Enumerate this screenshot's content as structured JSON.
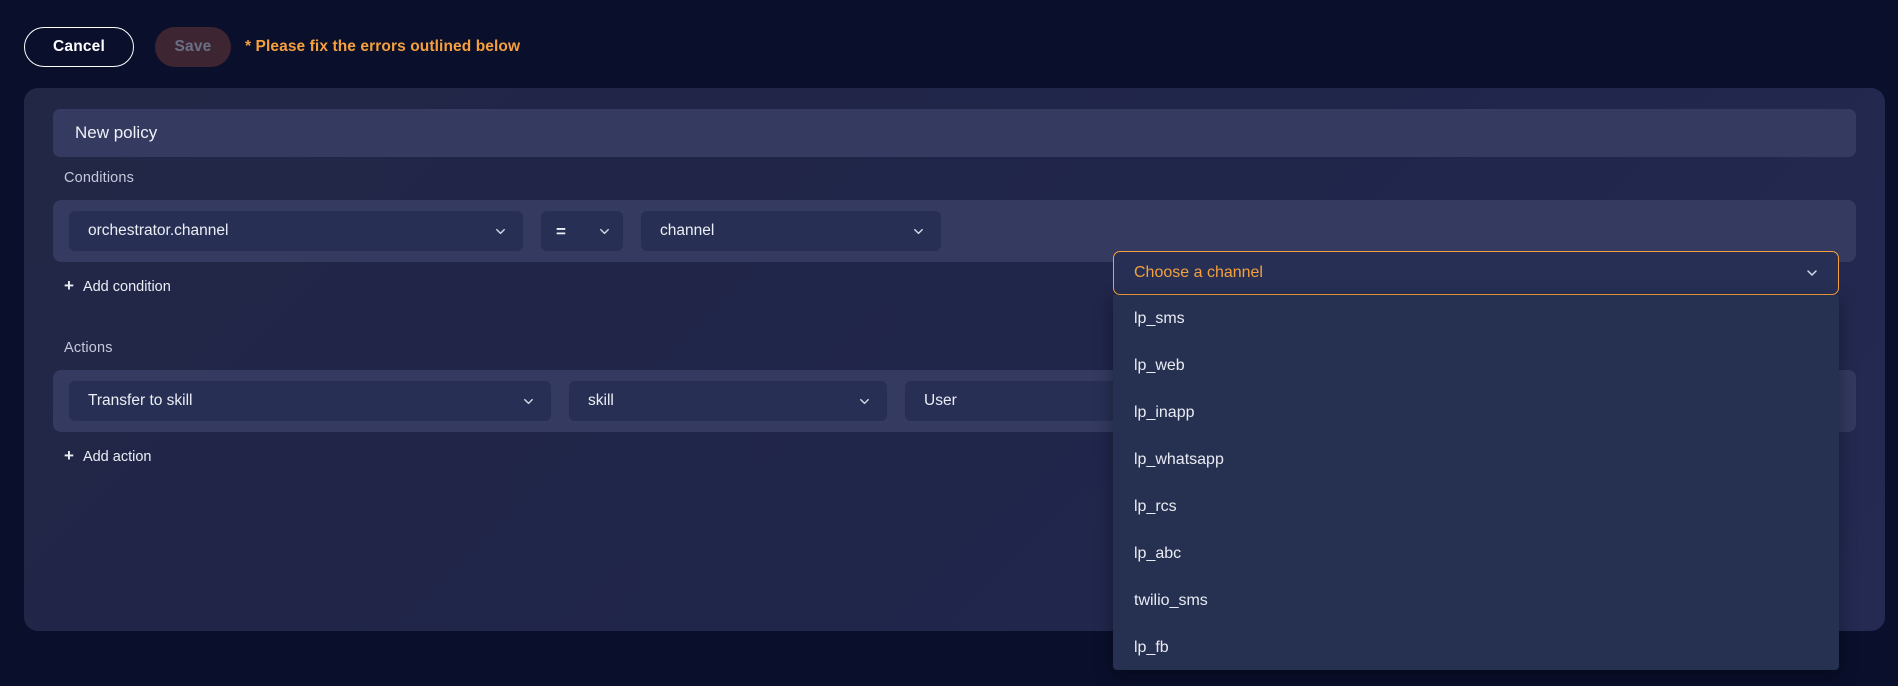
{
  "toolbar": {
    "cancel_label": "Cancel",
    "save_label": "Save",
    "error_message": "* Please fix the errors outlined below",
    "error_color": "#f5a03c"
  },
  "card": {
    "policy_title": "New policy",
    "conditions_label": "Conditions",
    "actions_label": "Actions",
    "add_condition_label": "Add condition",
    "add_action_label": "Add action",
    "plus_glyph": "+"
  },
  "condition_row": {
    "field": "orchestrator.channel",
    "operator": "=",
    "value_type": "channel"
  },
  "action_row": {
    "action": "Transfer to skill",
    "target_type": "skill",
    "target_value": "User"
  },
  "channel_dropdown": {
    "placeholder": "Choose a channel",
    "state": "invalid",
    "border_color": "#f5a03c",
    "options": [
      "lp_sms",
      "lp_web",
      "lp_inapp",
      "lp_whatsapp",
      "lp_rcs",
      "lp_abc",
      "twilio_sms",
      "lp_fb"
    ]
  }
}
